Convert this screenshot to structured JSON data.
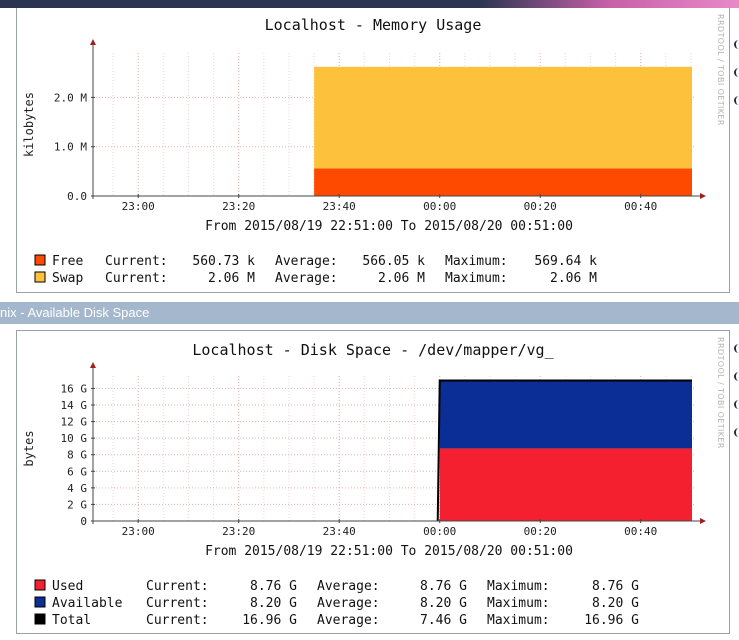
{
  "section_title": "nix - Available Disk Space",
  "credit": "RRDTOOL / TOBI OETIKER",
  "colors": {
    "free": "#fe4a00",
    "swap": "#fec13b",
    "used": "#f42030",
    "available": "#0a2d96",
    "total": "#000000",
    "grid": "#e6b0b0",
    "titlebar": "#a4b7cc"
  },
  "chart_data": [
    {
      "type": "area",
      "title": "Localhost - Memory Usage",
      "ylabel": "kilobytes",
      "xlabel": "From 2015/08/19 22:51:00 To 2015/08/20 00:51:00",
      "x_range": [
        "22:51",
        "00:51"
      ],
      "x_ticks": [
        "23:00",
        "23:20",
        "23:40",
        "00:00",
        "00:20",
        "00:40"
      ],
      "y_ticks": [
        "0.0",
        "1.0 M",
        "2.0 M"
      ],
      "ylim": [
        0,
        2.9
      ],
      "y_unit": "M",
      "data_start": "23:35",
      "stacked": true,
      "series": [
        {
          "name": "Free",
          "value": 0.56,
          "current": "560.73 k",
          "average": "566.05 k",
          "maximum": "569.64 k",
          "color_key": "free"
        },
        {
          "name": "Swap",
          "value": 2.06,
          "current": "2.06 M",
          "average": "2.06 M",
          "maximum": "2.06 M",
          "color_key": "swap"
        }
      ],
      "legend_labels": {
        "current": "Current:",
        "average": "Average:",
        "maximum": "Maximum:"
      }
    },
    {
      "type": "area",
      "title": "Localhost - Disk Space - /dev/mapper/vg_",
      "ylabel": "bytes",
      "xlabel": "From 2015/08/19 22:51:00 To 2015/08/20 00:51:00",
      "x_range": [
        "22:51",
        "00:51"
      ],
      "x_ticks": [
        "23:00",
        "23:20",
        "23:40",
        "00:00",
        "00:20",
        "00:40"
      ],
      "y_ticks": [
        "0",
        "2 G",
        "4 G",
        "6 G",
        "8 G",
        "10 G",
        "12 G",
        "14 G",
        "16 G"
      ],
      "ylim": [
        0,
        17.5
      ],
      "y_unit": "G",
      "data_start": "00:00",
      "stacked": true,
      "series": [
        {
          "name": "Used",
          "value": 8.76,
          "current": "8.76 G",
          "average": "8.76 G",
          "maximum": "8.76 G",
          "color_key": "used"
        },
        {
          "name": "Available",
          "value": 8.2,
          "current": "8.20 G",
          "average": "8.20 G",
          "maximum": "8.20 G",
          "color_key": "available"
        },
        {
          "name": "Total",
          "value": 16.96,
          "current": "16.96 G",
          "average": "7.46 G",
          "maximum": "16.96 G",
          "color_key": "total",
          "line": true
        }
      ],
      "legend_labels": {
        "current": "Current:",
        "average": "Average:",
        "maximum": "Maximum:"
      }
    }
  ]
}
